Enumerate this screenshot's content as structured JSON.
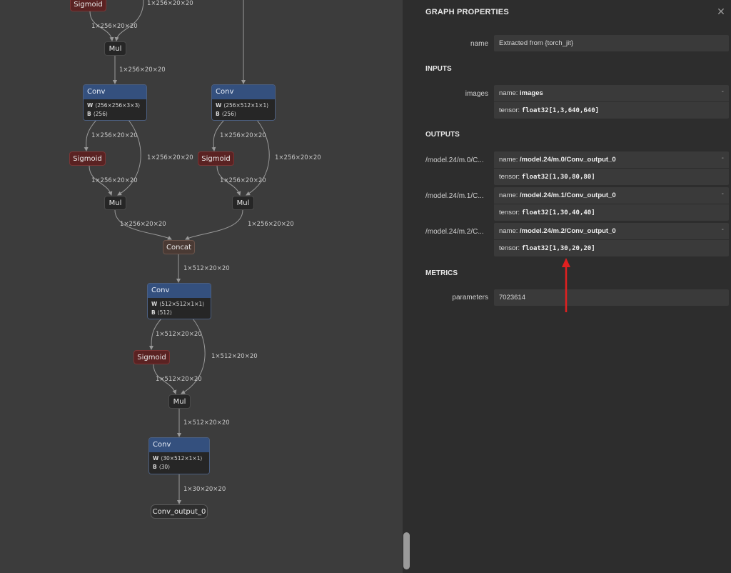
{
  "graph": {
    "edge_labels": {
      "e_top1": "1×256×20×20",
      "e_top2": "1×256×20×20",
      "e_mul0_conv0": "1×256×20×20",
      "e_conv0_sig": "1×256×20×20",
      "e_conv0_mul": "1×256×20×20",
      "e_sig0_mul": "1×256×20×20",
      "e_conv1_sig": "1×256×20×20",
      "e_conv1_mul": "1×256×20×20",
      "e_sig1_mul": "1×256×20×20",
      "e_mul1_concat": "1×256×20×20",
      "e_mul2_concat": "1×256×20×20",
      "e_concat_conv": "1×512×20×20",
      "e_conv2_sig": "1×512×20×20",
      "e_conv2_mul": "1×512×20×20",
      "e_sig2_mul": "1×512×20×20",
      "e_mul3_conv3": "1×512×20×20",
      "e_conv3_out": "1×30×20×20"
    },
    "nodes": {
      "sigmoid_top": "Sigmoid",
      "mul_top": "Mul",
      "conv_a": {
        "op": "Conv",
        "w": "⟨256×256×3×3⟩",
        "b": "⟨256⟩"
      },
      "conv_b": {
        "op": "Conv",
        "w": "⟨256×512×1×1⟩",
        "b": "⟨256⟩"
      },
      "sigmoid_a": "Sigmoid",
      "sigmoid_b": "Sigmoid",
      "mul_a": "Mul",
      "mul_b": "Mul",
      "concat": "Concat",
      "conv_c": {
        "op": "Conv",
        "w": "⟨512×512×1×1⟩",
        "b": "⟨512⟩"
      },
      "sigmoid_c": "Sigmoid",
      "mul_c": "Mul",
      "conv_d": {
        "op": "Conv",
        "w": "⟨30×512×1×1⟩",
        "b": "⟨30⟩"
      },
      "output": "Conv_output_0"
    },
    "w_label": "W",
    "b_label": "B"
  },
  "panel": {
    "title": "GRAPH PROPERTIES",
    "close_icon": "close-icon",
    "name_label": "name",
    "name_value": "Extracted from {torch_jit}",
    "inputs_heading": "INPUTS",
    "inputs": [
      {
        "label": "images",
        "name_key": "name: ",
        "name": "images",
        "tensor_key": "tensor: ",
        "tensor": "float32[1,3,640,640]"
      }
    ],
    "outputs_heading": "OUTPUTS",
    "outputs": [
      {
        "label": "/model.24/m.0/C...",
        "name_key": "name: ",
        "name": "/model.24/m.0/Conv_output_0",
        "tensor_key": "tensor: ",
        "tensor": "float32[1,30,80,80]"
      },
      {
        "label": "/model.24/m.1/C...",
        "name_key": "name: ",
        "name": "/model.24/m.1/Conv_output_0",
        "tensor_key": "tensor: ",
        "tensor": "float32[1,30,40,40]"
      },
      {
        "label": "/model.24/m.2/C...",
        "name_key": "name: ",
        "name": "/model.24/m.2/Conv_output_0",
        "tensor_key": "tensor: ",
        "tensor": "float32[1,30,20,20]"
      }
    ],
    "collapse_glyph": "-",
    "metrics_heading": "METRICS",
    "parameters_label": "parameters",
    "parameters_value": "7023614",
    "annotation_color": "#e02020"
  }
}
